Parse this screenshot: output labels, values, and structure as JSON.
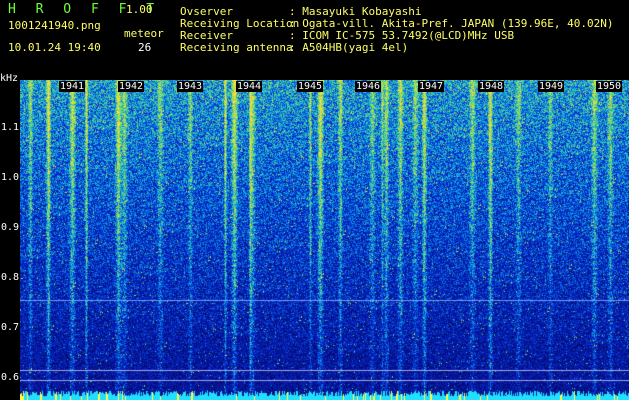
{
  "app": {
    "name": "H R O F F T",
    "version": "1.00"
  },
  "file": {
    "name": "1001241940.png",
    "datetime": "10.01.24 19:40"
  },
  "meteor": {
    "label": "meteor",
    "count": "26"
  },
  "station": {
    "observer_label": "Ovserver",
    "observer_value": ": Masayuki Kobayashi",
    "location_label": "Receiving Location",
    "location_value": ": Ogata-vill. Akita-Pref. JAPAN (139.96E, 40.02N)",
    "receiver_label": "Receiver",
    "receiver_value": ": ICOM IC-575 53.7492(@LCD)MHz USB",
    "antenna_label": "Receiving antenna",
    "antenna_value": ": A504HB(yagi 4el)"
  },
  "spectrogram": {
    "y_unit": "kHz",
    "y_ticks": [
      "1.1",
      "1.0",
      "0.9",
      "0.8",
      "0.7",
      "0.6"
    ],
    "x_ticks": [
      "1941",
      "1942",
      "1943",
      "1944",
      "1945",
      "1946",
      "1947",
      "1948",
      "1949",
      "1950"
    ]
  }
}
